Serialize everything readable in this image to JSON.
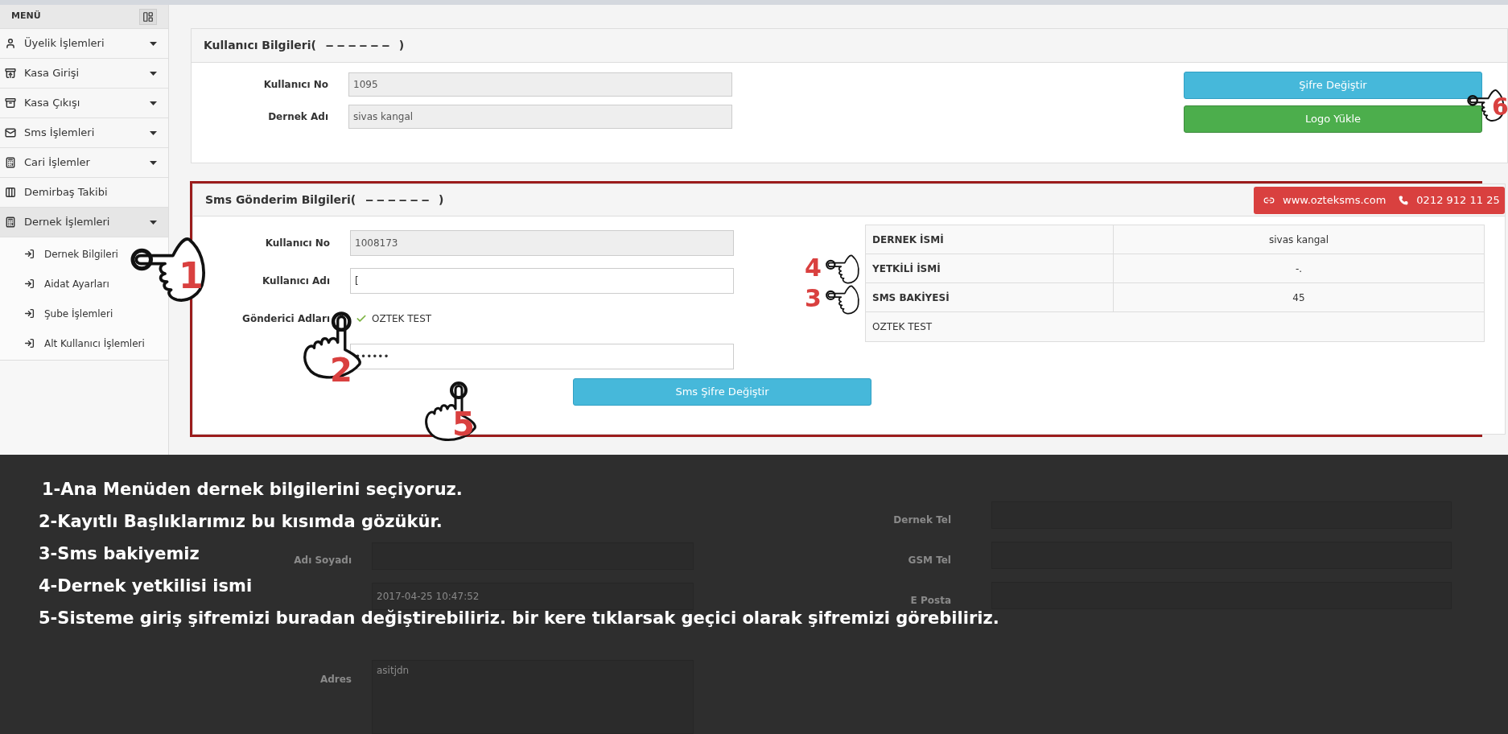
{
  "sidebar": {
    "title": "MENÜ",
    "items": [
      {
        "label": "Üyelik İşlemleri",
        "dropdown": true,
        "expanded": false
      },
      {
        "label": "Kasa Girişi",
        "dropdown": true,
        "expanded": false
      },
      {
        "label": "Kasa Çıkışı",
        "dropdown": true,
        "expanded": false
      },
      {
        "label": "Sms İşlemleri",
        "dropdown": true,
        "expanded": false
      },
      {
        "label": "Cari İşlemler",
        "dropdown": true,
        "expanded": false
      },
      {
        "label": "Demirbaş Takibi",
        "dropdown": false,
        "expanded": false
      },
      {
        "label": "Dernek İşlemleri",
        "dropdown": true,
        "expanded": true,
        "children": [
          {
            "label": "Dernek Bilgileri"
          },
          {
            "label": "Aidat Ayarları"
          },
          {
            "label": "Şube İşlemleri"
          },
          {
            "label": "Alt Kullanıcı İşlemleri"
          }
        ]
      }
    ]
  },
  "user_panel": {
    "title": "Kullanıcı Bilgileri(",
    "masked": "‒ ‒ ‒ ‒ ‒ ‒",
    "title_end": ")",
    "fields": [
      {
        "label": "Kullanıcı No",
        "value": "1095",
        "disabled": true
      },
      {
        "label": "Dernek Adı",
        "value": "sivas kangal",
        "disabled": true
      }
    ],
    "buttons": [
      {
        "label": "Şifre Değiştir",
        "kind": "info"
      },
      {
        "label": "Logo Yükle",
        "kind": "success"
      }
    ]
  },
  "sms_panel": {
    "title": "Sms Gönderim Bilgileri(",
    "masked": "‒ ‒ ‒ ‒ ‒ ‒",
    "title_end": ")",
    "website": "www.ozteksms.com",
    "phone": "0212 912 11 25",
    "fields": [
      {
        "kind": "input",
        "label": "Kullanıcı No",
        "value": "1008173",
        "disabled": true
      },
      {
        "kind": "input",
        "label": "Kullanıcı Adı",
        "value": "[",
        "disabled": false
      },
      {
        "kind": "check",
        "label": "Gönderici Adları",
        "value": "OZTEK TEST"
      },
      {
        "kind": "input",
        "value": "••••••",
        "disabled": false
      }
    ],
    "button": "Sms Şifre Değiştir",
    "table": [
      {
        "label": "DERNEK İSMİ",
        "value": "sivas kangal"
      },
      {
        "label": "YETKİLİ İSMİ",
        "value": "-."
      },
      {
        "label": "SMS BAKİYESİ",
        "value": "45"
      },
      {
        "label": "OZTEK TEST"
      }
    ]
  },
  "background_form": {
    "labels": [
      {
        "label": "Adı Soyadı"
      },
      {
        "label": "Adres"
      },
      {
        "label": "Dernek Tel"
      },
      {
        "label": "GSM Tel"
      },
      {
        "label": "E Posta"
      }
    ],
    "values": [
      "2017-04-25 10:47:52",
      "asitjdn"
    ]
  },
  "instructions": [
    "1-Ana Menüden dernek bilgilerini seçiyoruz.",
    "2-Kayıtlı Başlıklarımız bu kısımda gözükür.",
    "3-Sms bakiyemiz",
    "4-Dernek yetkilisi ismi",
    "5-Sisteme giriş şifremizi buradan değiştirebiliriz. bir kere tıklarsak geçici olarak şifremizi görebiliriz."
  ],
  "markers": [
    {
      "number": "1"
    },
    {
      "number": "2"
    },
    {
      "number": "3"
    },
    {
      "number": "4"
    },
    {
      "number": "5"
    },
    {
      "number": "6"
    }
  ]
}
